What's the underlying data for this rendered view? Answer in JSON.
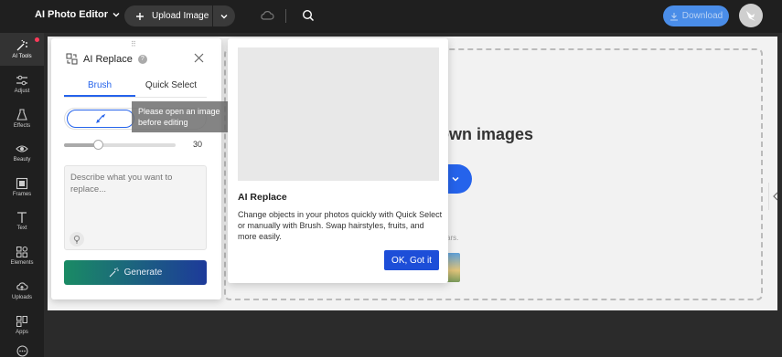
{
  "header": {
    "app_title": "AI Photo Editor",
    "upload_label": "Upload Image",
    "download_label": "Download"
  },
  "sidebar": {
    "items": [
      {
        "label": "AI Tools",
        "icon": "ai-tools-icon"
      },
      {
        "label": "Adjust",
        "icon": "adjust-icon"
      },
      {
        "label": "Effects",
        "icon": "effects-icon"
      },
      {
        "label": "Beauty",
        "icon": "beauty-icon"
      },
      {
        "label": "Frames",
        "icon": "frames-icon"
      },
      {
        "label": "Text",
        "icon": "text-icon"
      },
      {
        "label": "Elements",
        "icon": "elements-icon"
      },
      {
        "label": "Uploads",
        "icon": "uploads-icon"
      },
      {
        "label": "Apps",
        "icon": "apps-icon"
      }
    ]
  },
  "panel": {
    "title": "AI Replace",
    "tabs": [
      "Brush",
      "Quick Select"
    ],
    "brush_size": "30",
    "brush_size_fraction": 0.3,
    "prompt_placeholder": "Describe what you want to replace...",
    "generate_label": "Generate"
  },
  "tooltip": {
    "text": "Please open an image before editing"
  },
  "canvas": {
    "title_fragment": "own images",
    "note_fragment": "ars."
  },
  "card": {
    "title": "AI Replace",
    "body": "Change objects in your photos quickly with Quick Select or manually with Brush. Swap hairstyles, fruits, and more easily.",
    "ok_label": "OK, Got it"
  },
  "colors": {
    "accent": "#2563eb",
    "topbar": "#1f1f1f",
    "download": "#4a8de8",
    "badge": "#ff3a5a"
  }
}
